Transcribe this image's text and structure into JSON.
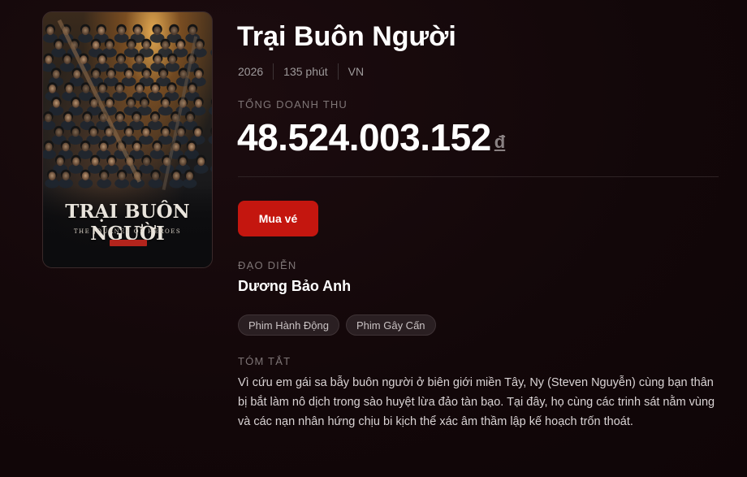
{
  "movie": {
    "title": "Trại Buôn Người",
    "year": "2026",
    "duration": "135 phút",
    "country": "VN"
  },
  "revenue": {
    "label": "TỔNG DOANH THU",
    "amount": "48.524.003.152",
    "currency": "đ"
  },
  "actions": {
    "buy_label": "Mua vé"
  },
  "director": {
    "label": "ĐẠO DIỄN",
    "name": "Dương Bảo Anh"
  },
  "genres": [
    "Phim Hành Động",
    "Phim Gây Cấn"
  ],
  "synopsis": {
    "label": "TÓM TẮT",
    "text": "Vì cứu em gái sa bẫy buôn người ở biên giới miền Tây, Ny (Steven Nguyễn) cùng bạn thân bị bắt làm nô dịch trong sào huyệt lừa đảo tàn bạo. Tại đây, họ cùng các trinh sát nằm vùng và các nạn nhân hứng chịu bi kịch thể xác âm thầm lập kế hoạch trốn thoát."
  },
  "poster": {
    "title_text": "TRẠI BUÔN NGƯỜI",
    "subtitle_text": "THE JOURNEY OF HEROES"
  },
  "colors": {
    "background": "#120709",
    "accent": "#c4160f",
    "muted": "#9e9a9b"
  }
}
